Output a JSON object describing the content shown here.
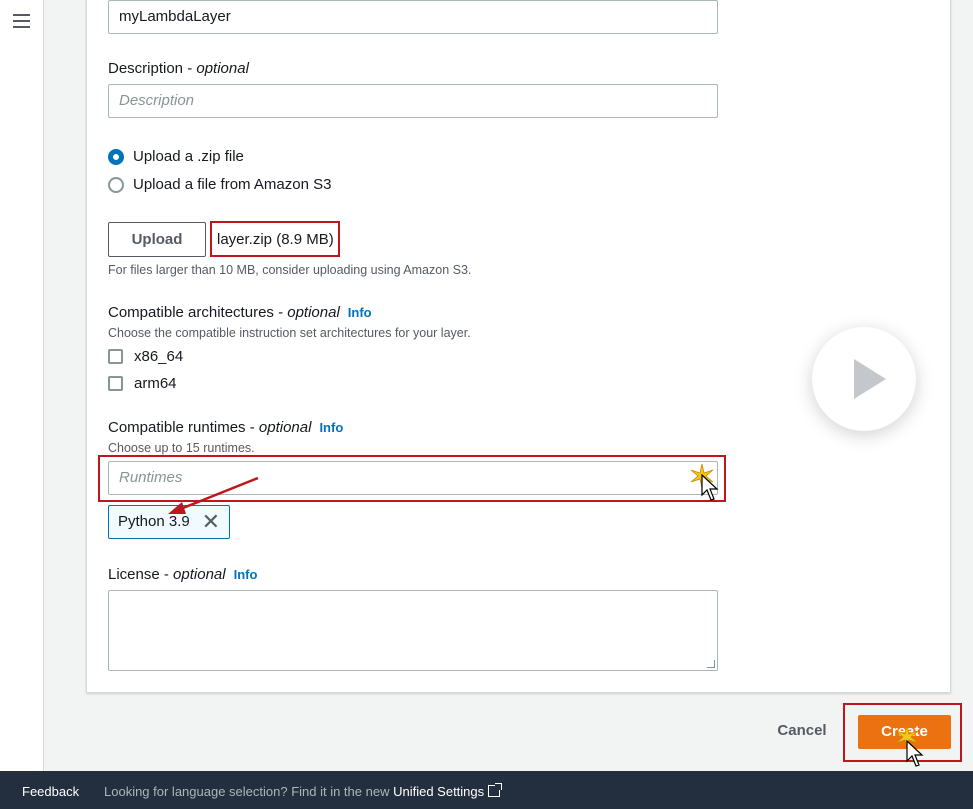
{
  "layer_name": {
    "value": "myLambdaLayer"
  },
  "description": {
    "label": "Description - ",
    "optional": "optional",
    "placeholder": "Description"
  },
  "upload_options": [
    {
      "label": "Upload a .zip file",
      "selected": true
    },
    {
      "label": "Upload a file from Amazon S3",
      "selected": false
    }
  ],
  "upload": {
    "button_label": "Upload",
    "file": "layer.zip (8.9 MB)",
    "hint": "For files larger than 10 MB, consider uploading using Amazon S3."
  },
  "architectures": {
    "label": "Compatible architectures - ",
    "optional": "optional",
    "info": "Info",
    "hint": "Choose the compatible instruction set architectures for your layer.",
    "options": [
      "x86_64",
      "arm64"
    ]
  },
  "runtimes": {
    "label": "Compatible runtimes - ",
    "optional": "optional",
    "info": "Info",
    "hint": "Choose up to 15 runtimes.",
    "placeholder": "Runtimes",
    "selected_token": "Python 3.9"
  },
  "license": {
    "label": "License - ",
    "optional": "optional",
    "info": "Info"
  },
  "actions": {
    "cancel": "Cancel",
    "create": "Create"
  },
  "footer": {
    "feedback": "Feedback",
    "message": "Looking for language selection? Find it in the new ",
    "link": "Unified Settings"
  },
  "colors": {
    "primary": "#ec7211",
    "link": "#0073bb",
    "annotation": "#c0151d",
    "footer_bg": "#232f3e"
  },
  "icons": [
    "menu-icon",
    "close-icon",
    "external-link-icon",
    "play-icon",
    "cursor-icon"
  ]
}
